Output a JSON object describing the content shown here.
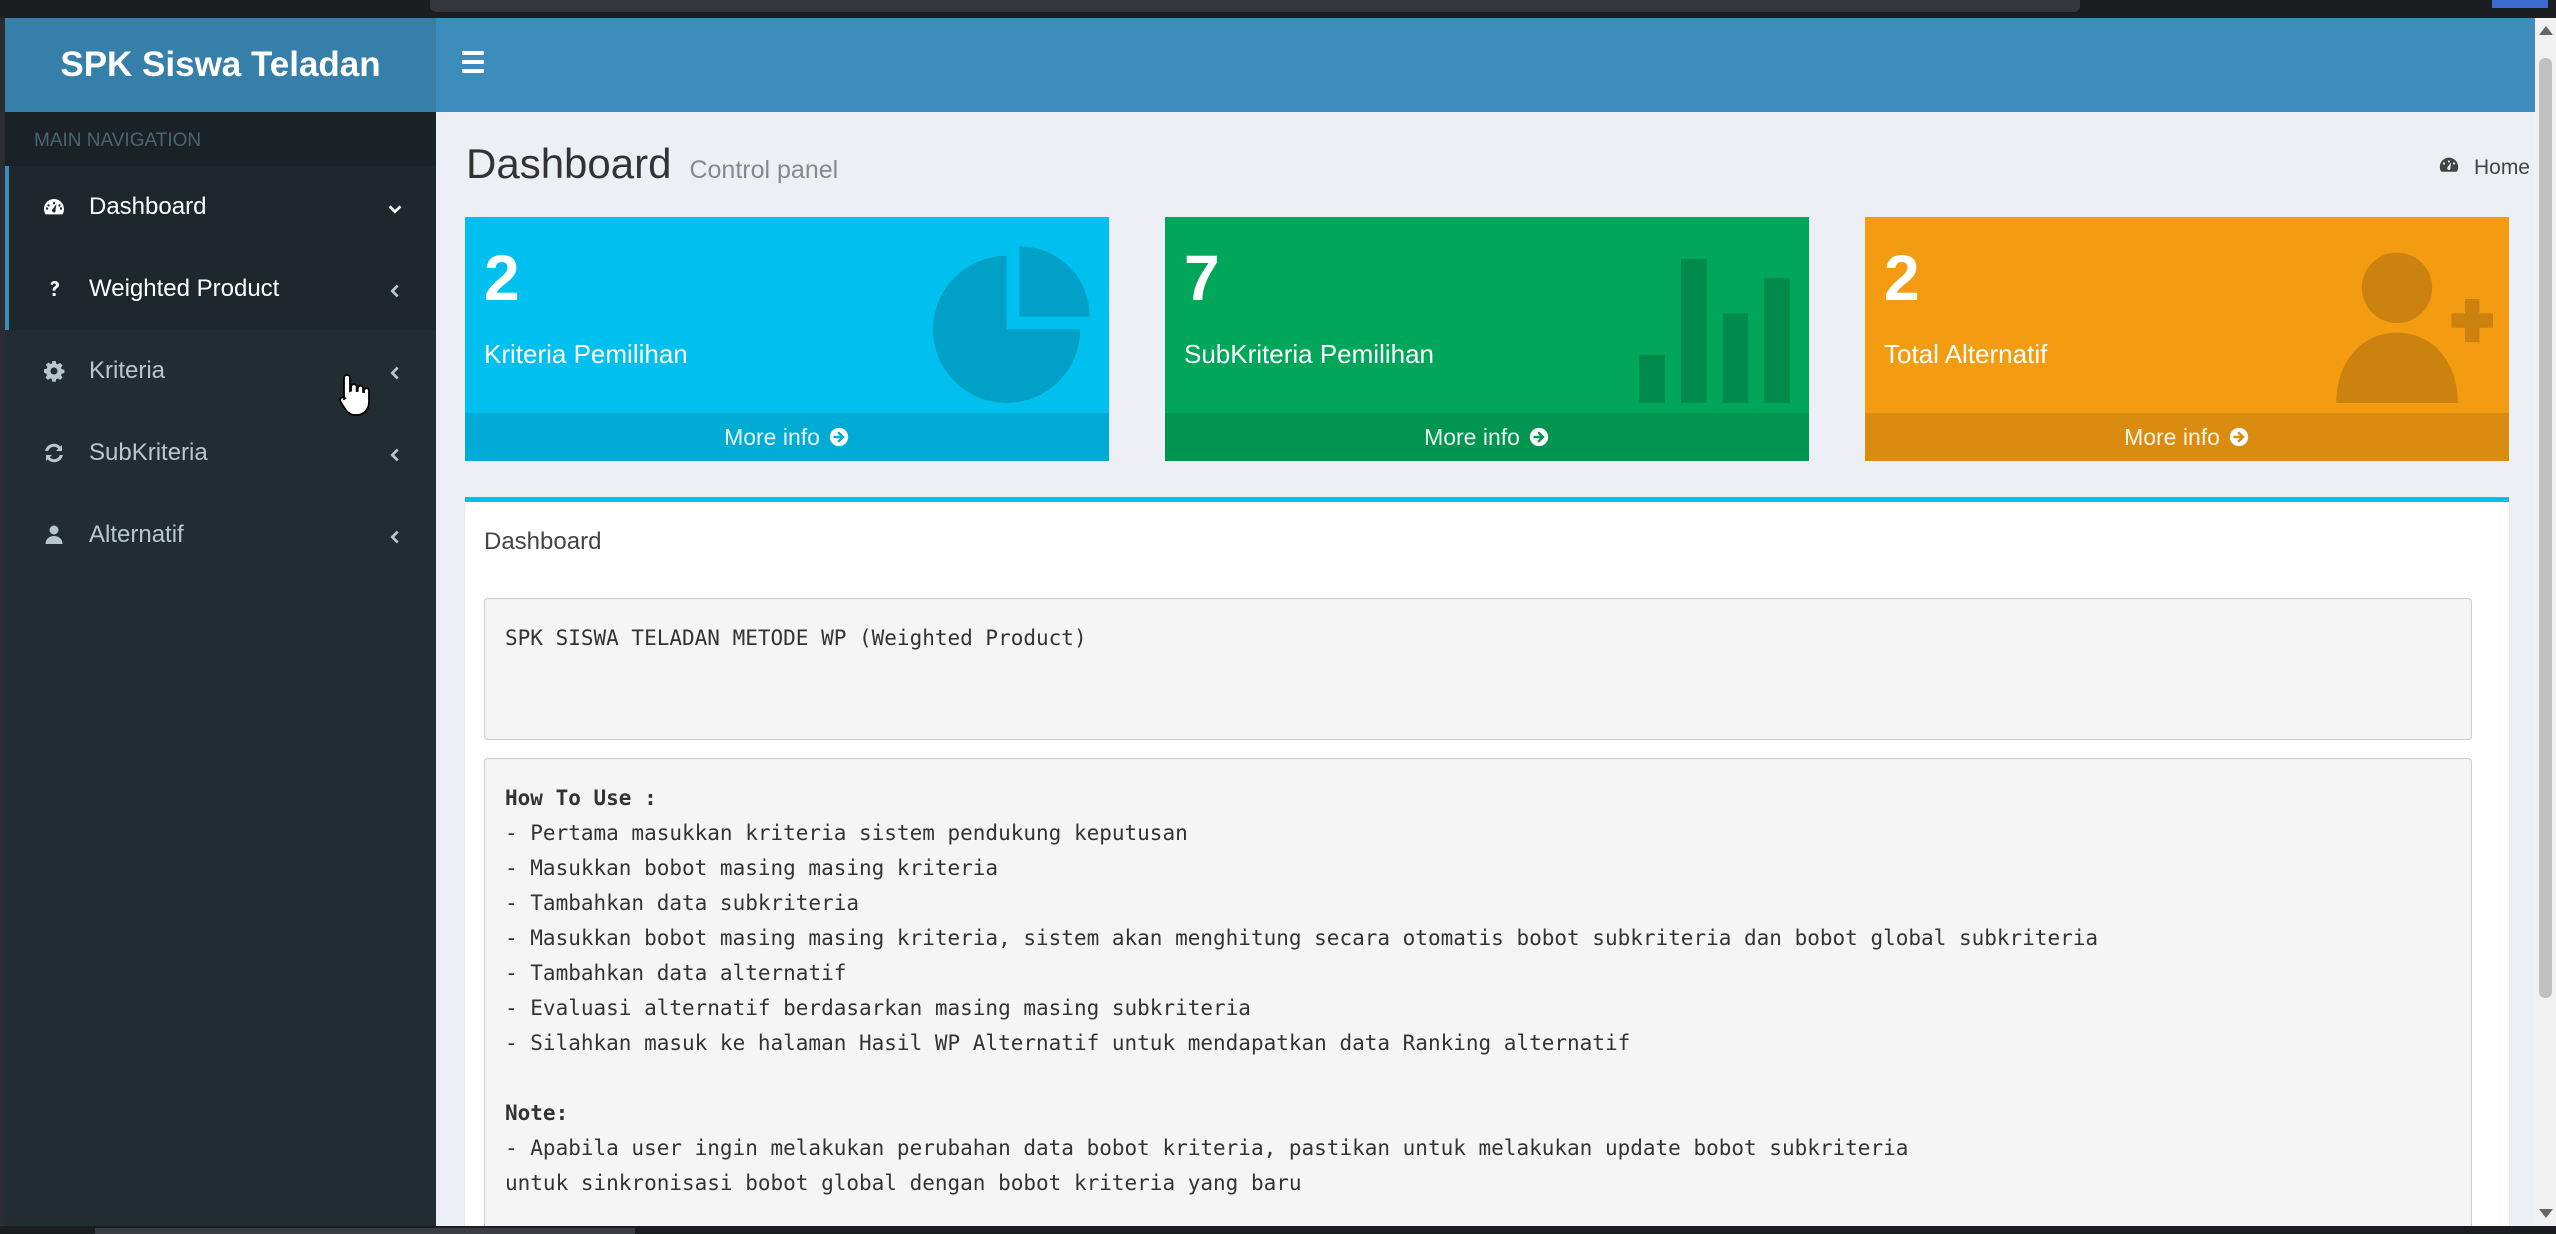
{
  "header": {
    "logo": "SPK Siswa Teladan",
    "toggle_icon": "bars-icon"
  },
  "sidebar": {
    "section_label": "MAIN NAVIGATION",
    "items": [
      {
        "label": "Dashboard",
        "icon": "dashboard-icon"
      },
      {
        "label": "Weighted Product",
        "icon": "question-icon"
      },
      {
        "label": "Kriteria",
        "icon": "gear-icon"
      },
      {
        "label": "SubKriteria",
        "icon": "refresh-icon"
      },
      {
        "label": "Alternatif",
        "icon": "user-icon"
      }
    ]
  },
  "page": {
    "title": "Dashboard",
    "subtitle": "Control panel",
    "breadcrumb": "Home"
  },
  "stats": [
    {
      "value": "2",
      "label": "Kriteria Pemilihan",
      "more": "More info",
      "color": "#00c0ef",
      "icon": "pie-chart-icon"
    },
    {
      "value": "7",
      "label": "SubKriteria Pemilihan",
      "more": "More info",
      "color": "#00a65a",
      "icon": "bar-chart-icon"
    },
    {
      "value": "2",
      "label": "Total Alternatif",
      "more": "More info",
      "color": "#f39c12",
      "icon": "user-plus-icon"
    }
  ],
  "panel": {
    "title": "Dashboard",
    "intro": "SPK SISWA TELADAN METODE WP (Weighted Product)",
    "howto_heading": "How To Use :",
    "howto_lines": [
      "- Pertama masukkan kriteria sistem pendukung keputusan",
      "- Masukkan bobot masing masing kriteria",
      "- Tambahkan data subkriteria",
      "- Masukkan bobot masing masing kriteria, sistem akan menghitung secara otomatis bobot subkriteria dan bobot global subkriteria",
      "- Tambahkan data alternatif",
      "- Evaluasi alternatif berdasarkan masing masing subkriteria",
      "- Silahkan masuk ke halaman Hasil WP Alternatif untuk mendapatkan data Ranking alternatif"
    ],
    "note_heading": "Note:",
    "note_lines": [
      "- Apabila user ingin melakukan perubahan data bobot kriteria, pastikan untuk melakukan update bobot subkriteria",
      "untuk sinkronisasi bobot global dengan bobot kriteria yang baru"
    ]
  },
  "colors": {
    "header": "#3c8dbc",
    "logo_bg": "#367fa9",
    "sidebar": "#222d32",
    "accent": "#00c0ef"
  }
}
